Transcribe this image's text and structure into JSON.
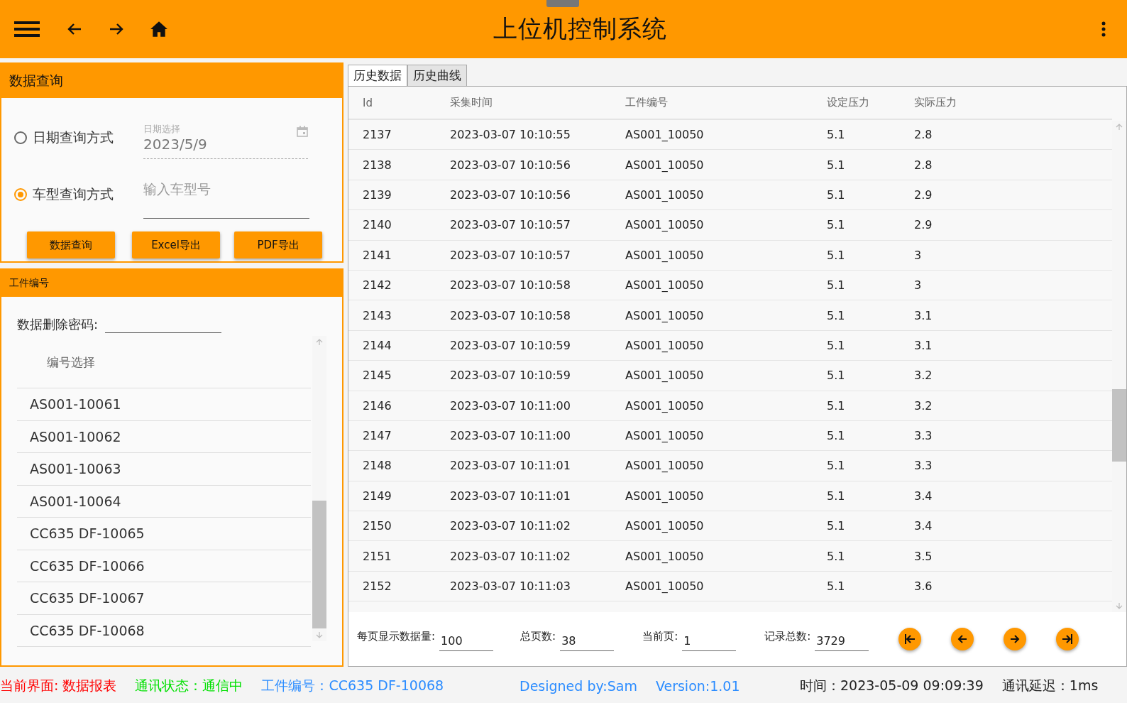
{
  "header": {
    "title": "上位机控制系统"
  },
  "query_panel": {
    "title": "数据查询",
    "modes": [
      {
        "label": "日期查询方式",
        "selected": false
      },
      {
        "label": "车型查询方式",
        "selected": true
      }
    ],
    "date_field": {
      "label": "日期选择",
      "value": "2023/5/9"
    },
    "model_field": {
      "placeholder": "输入车型号"
    },
    "buttons": [
      "数据查询",
      "Excel导出",
      "PDF导出"
    ]
  },
  "part_panel": {
    "title": "工件编号",
    "password_label": "数据删除密码:",
    "list_header": "编号选择",
    "items": [
      "AS001-10061",
      "AS001-10062",
      "AS001-10063",
      "AS001-10064",
      "CC635 DF-10065",
      "CC635 DF-10066",
      "CC635 DF-10067",
      "CC635 DF-10068"
    ]
  },
  "tabs": [
    {
      "label": "历史数据",
      "selected": true
    },
    {
      "label": "历史曲线",
      "selected": false
    }
  ],
  "table": {
    "columns": [
      "Id",
      "采集时间",
      "工件编号",
      "设定压力",
      "实际压力"
    ],
    "rows": [
      [
        "2137",
        "2023-03-07 10:10:55",
        "AS001_10050",
        "5.1",
        "2.8"
      ],
      [
        "2138",
        "2023-03-07 10:10:56",
        "AS001_10050",
        "5.1",
        "2.8"
      ],
      [
        "2139",
        "2023-03-07 10:10:56",
        "AS001_10050",
        "5.1",
        "2.9"
      ],
      [
        "2140",
        "2023-03-07 10:10:57",
        "AS001_10050",
        "5.1",
        "2.9"
      ],
      [
        "2141",
        "2023-03-07 10:10:57",
        "AS001_10050",
        "5.1",
        "3"
      ],
      [
        "2142",
        "2023-03-07 10:10:58",
        "AS001_10050",
        "5.1",
        "3"
      ],
      [
        "2143",
        "2023-03-07 10:10:58",
        "AS001_10050",
        "5.1",
        "3.1"
      ],
      [
        "2144",
        "2023-03-07 10:10:59",
        "AS001_10050",
        "5.1",
        "3.1"
      ],
      [
        "2145",
        "2023-03-07 10:10:59",
        "AS001_10050",
        "5.1",
        "3.2"
      ],
      [
        "2146",
        "2023-03-07 10:11:00",
        "AS001_10050",
        "5.1",
        "3.2"
      ],
      [
        "2147",
        "2023-03-07 10:11:00",
        "AS001_10050",
        "5.1",
        "3.3"
      ],
      [
        "2148",
        "2023-03-07 10:11:01",
        "AS001_10050",
        "5.1",
        "3.3"
      ],
      [
        "2149",
        "2023-03-07 10:11:01",
        "AS001_10050",
        "5.1",
        "3.4"
      ],
      [
        "2150",
        "2023-03-07 10:11:02",
        "AS001_10050",
        "5.1",
        "3.4"
      ],
      [
        "2151",
        "2023-03-07 10:11:02",
        "AS001_10050",
        "5.1",
        "3.5"
      ],
      [
        "2152",
        "2023-03-07 10:11:03",
        "AS001_10050",
        "5.1",
        "3.6"
      ]
    ]
  },
  "pager": {
    "fields": [
      {
        "label": "每页显示数据量:",
        "value": "100"
      },
      {
        "label": "总页数:",
        "value": "38"
      },
      {
        "label": "当前页:",
        "value": "1"
      },
      {
        "label": "记录总数:",
        "value": "3729"
      }
    ]
  },
  "status_bar": {
    "left": [
      {
        "text": "当前界面: 数据报表",
        "color": "#ff0000"
      },
      {
        "text": "通讯状态：通信中",
        "color": "#00e000"
      },
      {
        "text": "工件编号：CC635 DF-10068",
        "color": "#2b8cff"
      }
    ],
    "center": [
      {
        "text": "Designed by:Sam",
        "color": "#2b8cff"
      },
      {
        "text": "Version:1.01",
        "color": "#2b8cff"
      }
    ],
    "right": [
      {
        "text": "时间：2023-05-09 09:09:39",
        "color": "#222222"
      },
      {
        "text": "通讯延迟：1ms",
        "color": "#222222"
      }
    ]
  }
}
